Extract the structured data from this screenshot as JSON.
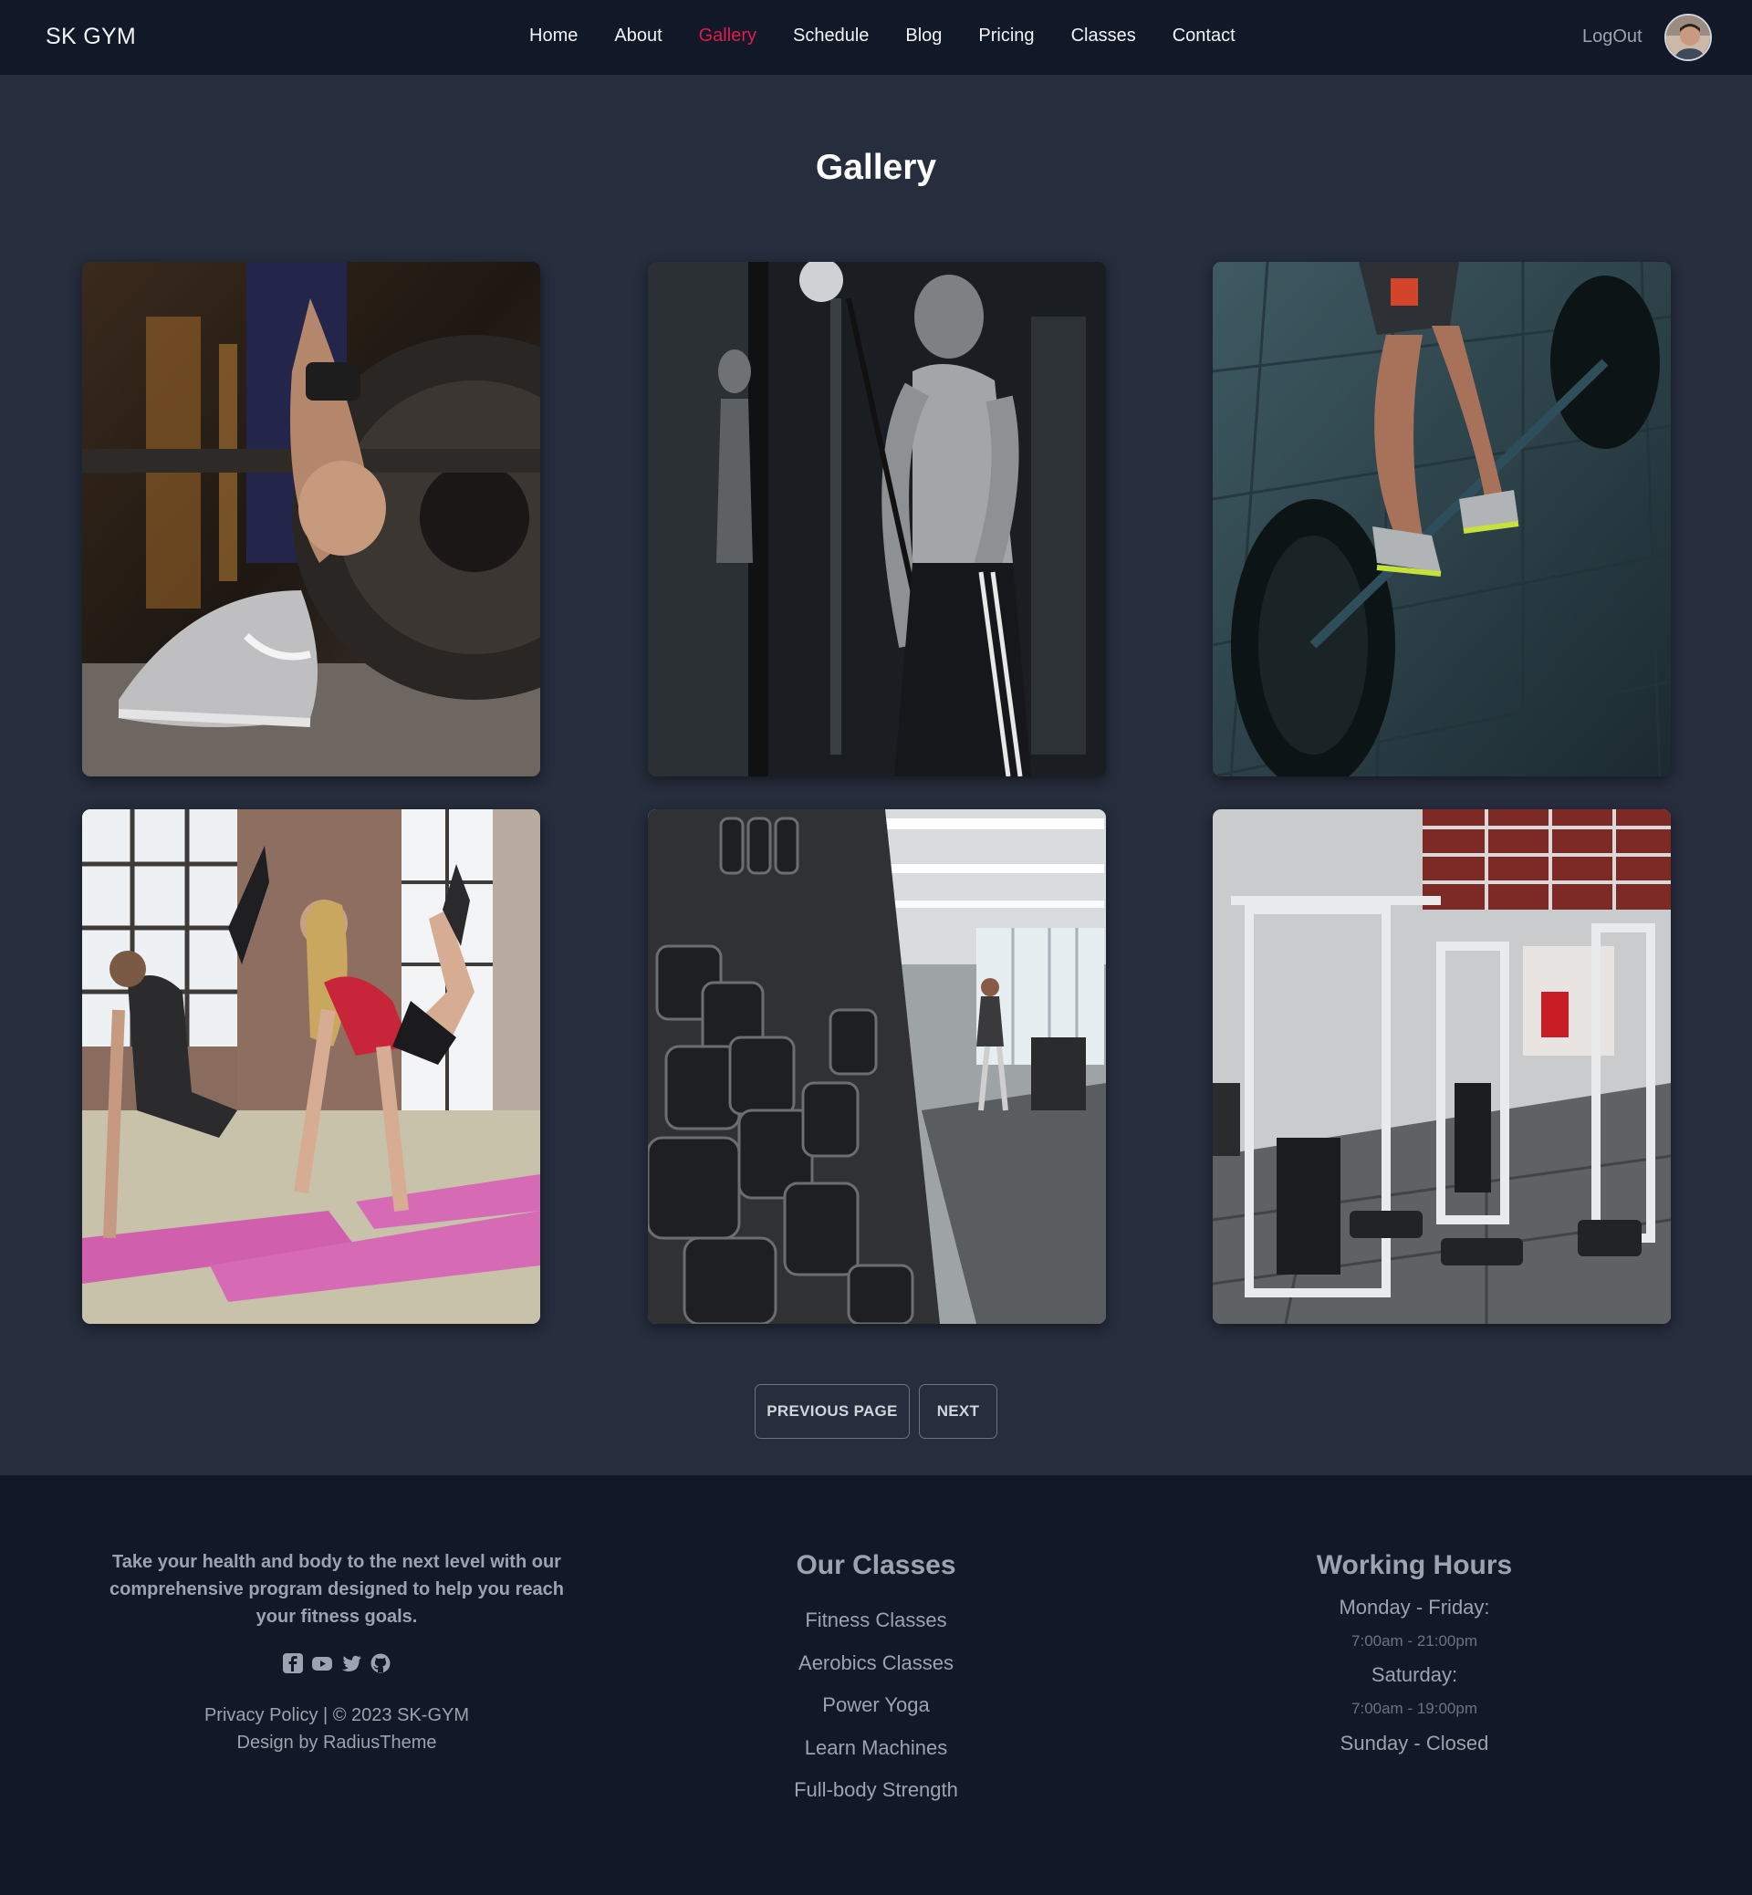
{
  "nav": {
    "brand": "SK GYM",
    "links": [
      {
        "label": "Home",
        "active": false
      },
      {
        "label": "About",
        "active": false
      },
      {
        "label": "Gallery",
        "active": true
      },
      {
        "label": "Schedule",
        "active": false
      },
      {
        "label": "Blog",
        "active": false
      },
      {
        "label": "Pricing",
        "active": false
      },
      {
        "label": "Classes",
        "active": false
      },
      {
        "label": "Contact",
        "active": false
      }
    ],
    "logout": "LogOut"
  },
  "page": {
    "title": "Gallery"
  },
  "pagination": {
    "previous": "PREVIOUS PAGE",
    "next": "NEXT"
  },
  "footer": {
    "blurb": "Take your health and body to the next level with our comprehensive program designed to help you reach your fitness goals.",
    "socials": [
      "facebook-icon",
      "youtube-icon",
      "twitter-icon",
      "github-icon"
    ],
    "privacy": "Privacy Policy",
    "copyright": "| © 2023 SK-GYM",
    "design_credit": "Design by RadiusTheme",
    "classes": {
      "heading": "Our Classes",
      "items": [
        "Fitness Classes",
        "Aerobics Classes",
        "Power Yoga",
        "Learn Machines",
        "Full-body Strength"
      ]
    },
    "hours": {
      "heading": "Working Hours",
      "weekday_label": "Monday - Friday:",
      "weekday_time": "7:00am - 21:00pm",
      "saturday_label": "Saturday:",
      "saturday_time": "7:00am - 19:00pm",
      "sunday": "Sunday - Closed"
    }
  },
  "colors": {
    "navbar_bg": "#111827",
    "page_bg": "#262d3d",
    "accent_active": "#e11d48",
    "footer_text": "#9ca3af"
  }
}
